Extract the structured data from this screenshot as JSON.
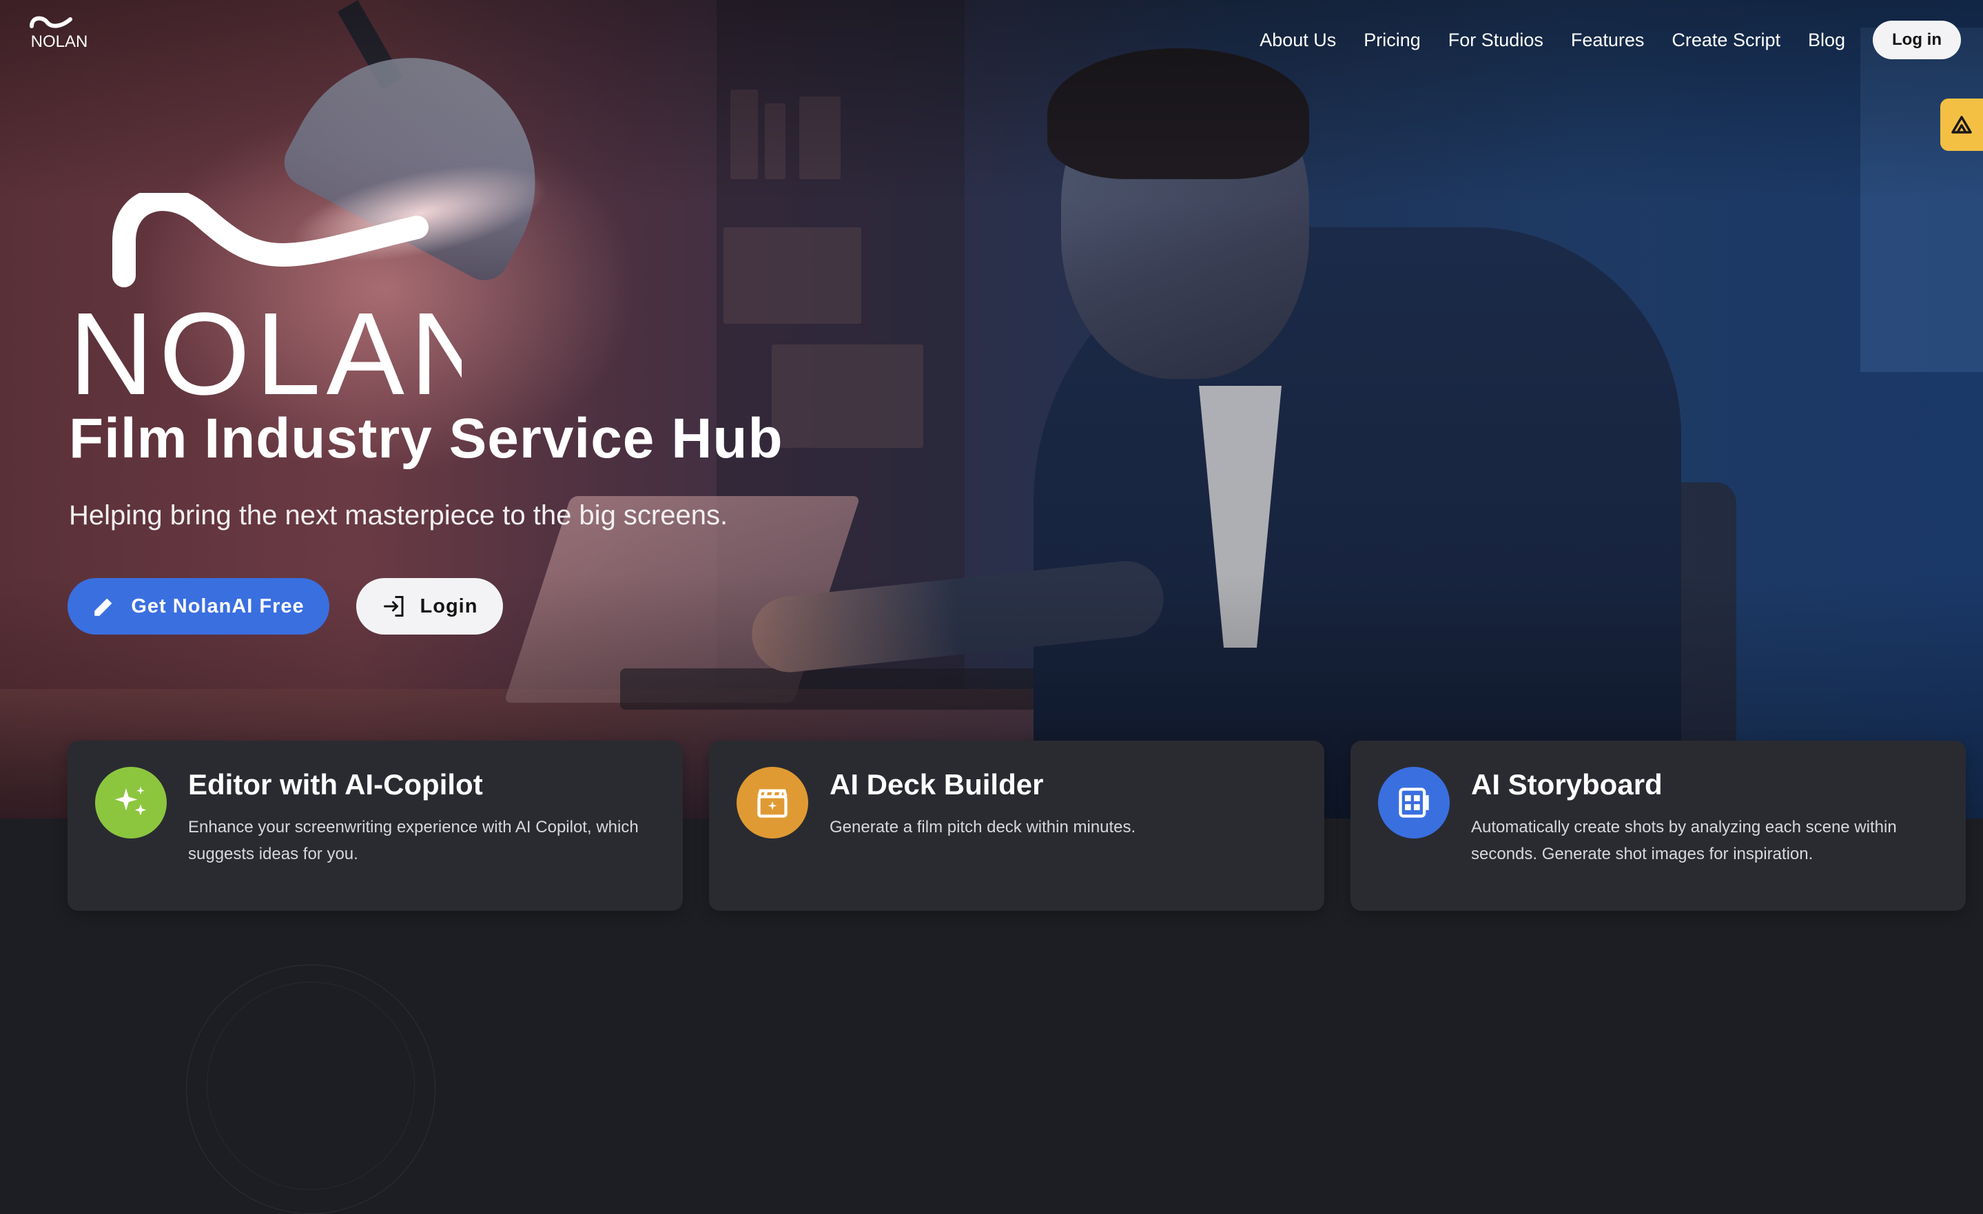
{
  "brand": {
    "name": "NOLAN"
  },
  "nav": {
    "links": [
      "About Us",
      "Pricing",
      "For Studios",
      "Features",
      "Create Script",
      "Blog"
    ],
    "login_label": "Log in"
  },
  "hero": {
    "title": "Film Industry Service Hub",
    "subtitle": "Helping bring the next masterpiece to the big screens.",
    "primary_cta": "Get NolanAI Free",
    "secondary_cta": "Login"
  },
  "features": [
    {
      "title": "Editor with AI-Copilot",
      "description": "Enhance your screenwriting experience with AI Copilot, which suggests ideas for you.",
      "icon": "sparkles-icon",
      "color": "#8cc63f"
    },
    {
      "title": "AI Deck Builder",
      "description": "Generate a film pitch deck within minutes.",
      "icon": "clapperboard-icon",
      "color": "#e09a33"
    },
    {
      "title": "AI Storyboard",
      "description": "Automatically create shots by analyzing each scene within seconds. Generate shot images for inspiration.",
      "icon": "storyboard-icon",
      "color": "#3a6fe0"
    }
  ],
  "colors": {
    "accent": "#3a6fe0",
    "side_tab": "#f4c044",
    "background": "#1d1e23",
    "card": "#2a2b31"
  }
}
